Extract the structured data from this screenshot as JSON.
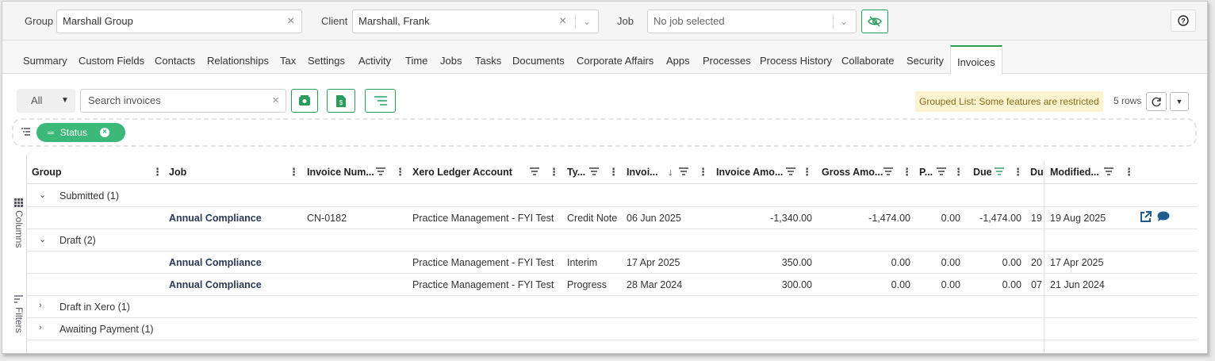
{
  "topbar": {
    "group_label": "Group",
    "group_value": "Marshall Group",
    "client_label": "Client",
    "client_value": "Marshall, Frank",
    "job_label": "Job",
    "job_placeholder": "No job selected",
    "help_symbol": "?"
  },
  "tabs": [
    "Summary",
    "Custom Fields",
    "Contacts",
    "Relationships",
    "Tax",
    "Settings",
    "Activity",
    "Time",
    "Jobs",
    "Tasks",
    "Documents",
    "Corporate Affairs",
    "Apps",
    "Processes",
    "Process History",
    "Collaborate",
    "Security",
    "Invoices"
  ],
  "active_tab": "Invoices",
  "toolbar": {
    "filter_value": "All",
    "search_placeholder": "Search invoices",
    "restricted_notice": "Grouped List: Some features are restricted",
    "rows_count": "5 rows"
  },
  "group_panel": {
    "pill_label": "Status"
  },
  "side_rail": {
    "columns": "Columns",
    "filters": "Filters"
  },
  "columns": {
    "group": "Group",
    "job": "Job",
    "invoice_number": "Invoice Num...",
    "xero_ledger": "Xero Ledger Account",
    "type": "Ty...",
    "invoice_date": "Invoi...",
    "invoice_amount": "Invoice Amo...",
    "gross_amount": "Gross Amo...",
    "paid": "P...",
    "due": "Due",
    "due_date": "Du",
    "modified": "Modified..."
  },
  "rows": [
    {
      "kind": "group",
      "toggle": "⌄",
      "label": "Submitted (1)"
    },
    {
      "kind": "data",
      "job": "Annual Compliance",
      "invoice_number": "CN-0182",
      "xero_ledger": "Practice Management - FYI Test",
      "type": "Credit Note",
      "invoice_date": "06 Jun 2025",
      "invoice_amount": "-1,340.00",
      "gross_amount": "-1,474.00",
      "paid": "0.00",
      "due": "-1,474.00",
      "due_date": "19 .",
      "modified": "19 Aug 2025",
      "actions": true
    },
    {
      "kind": "group",
      "toggle": "⌄",
      "label": "Draft (2)"
    },
    {
      "kind": "data",
      "job": "Annual Compliance",
      "invoice_number": "",
      "xero_ledger": "Practice Management - FYI Test",
      "type": "Interim",
      "invoice_date": "17 Apr 2025",
      "invoice_amount": "350.00",
      "gross_amount": "0.00",
      "paid": "0.00",
      "due": "0.00",
      "due_date": "20",
      "modified": "17 Apr 2025",
      "actions": false
    },
    {
      "kind": "data",
      "job": "Annual Compliance",
      "invoice_number": "",
      "xero_ledger": "Practice Management - FYI Test",
      "type": "Progress",
      "invoice_date": "28 Mar 2024",
      "invoice_amount": "300.00",
      "gross_amount": "0.00",
      "paid": "0.00",
      "due": "0.00",
      "due_date": "07 .",
      "modified": "21 Jun 2024",
      "actions": false
    },
    {
      "kind": "group",
      "toggle": "›",
      "label": "Draft in Xero (1)"
    },
    {
      "kind": "group",
      "toggle": "›",
      "label": "Awaiting Payment (1)"
    }
  ],
  "colors": {
    "accent": "#2a9d5c",
    "pill": "#3cb878",
    "notice_bg": "#fdf3cf",
    "link_icon": "#1f5e8c"
  }
}
